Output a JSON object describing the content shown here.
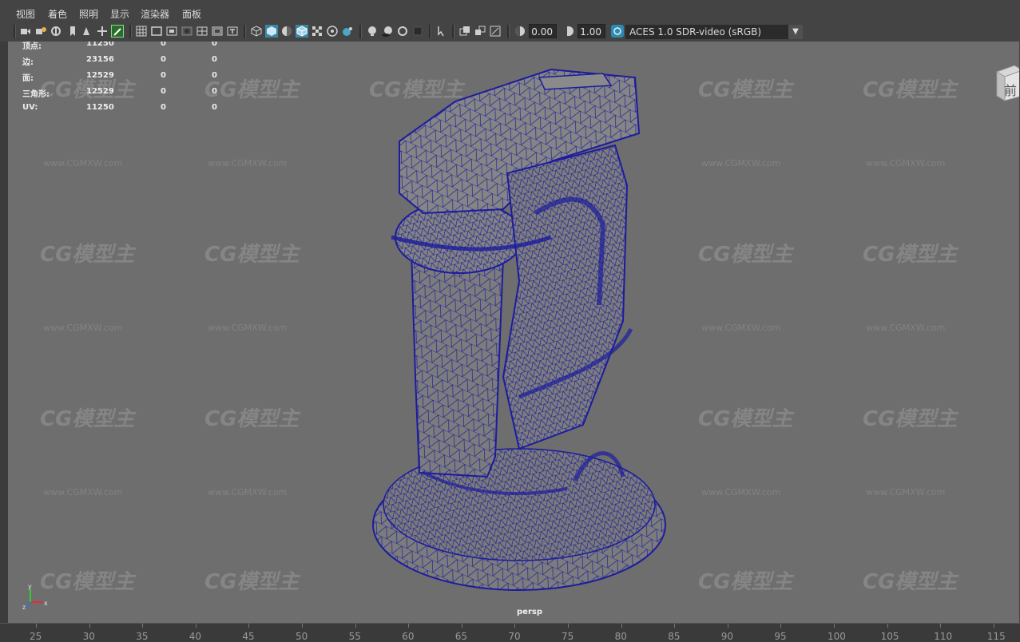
{
  "menu": [
    "视图",
    "着色",
    "照明",
    "显示",
    "渲染器",
    "面板"
  ],
  "toolbar": {
    "exposure": "0.00",
    "gamma": "1.00",
    "colorspace": "ACES 1.0 SDR-video (sRGB)",
    "icons": [
      "camera-icon",
      "camera-attributes-icon",
      "bookmark-icon",
      "image-plane-icon",
      "2d-pan-zoom-icon",
      "grease-pencil-icon",
      "grid-icon",
      "film-gate-icon",
      "resolution-gate-icon",
      "gate-mask-icon",
      "field-chart-icon",
      "safe-action-icon",
      "safe-title-icon",
      "wireframe-icon",
      "smooth-shade-icon",
      "default-material-icon",
      "wireframe-on-shaded-icon",
      "xray-icon",
      "xray-joints-icon",
      "xray-components-icon",
      "use-all-lights-icon",
      "shadows-icon",
      "screen-space-ao-icon",
      "motion-blur-icon",
      "multisample-aa-icon",
      "depth-of-field-icon",
      "isolate-select-icon",
      "heads-up-display-icon",
      "exposure-icon",
      "gamma-icon",
      "color-management-icon"
    ]
  },
  "hud": {
    "rows": [
      {
        "label": "顶点:",
        "v1": "11250",
        "v2": "0",
        "v3": "0"
      },
      {
        "label": "边:",
        "v1": "23156",
        "v2": "0",
        "v3": "0"
      },
      {
        "label": "面:",
        "v1": "12529",
        "v2": "0",
        "v3": "0"
      },
      {
        "label": "三角形:",
        "v1": "12529",
        "v2": "0",
        "v3": "0"
      },
      {
        "label": "UV:",
        "v1": "11250",
        "v2": "0",
        "v3": "0"
      }
    ]
  },
  "watermark": {
    "logo": "CG模型主",
    "url": "www.CGMXW.com"
  },
  "viewport": {
    "camera": "persp",
    "viewcube_face": "前"
  },
  "axis": {
    "x": "x",
    "y": "y",
    "z": "z"
  },
  "timeline": {
    "ticks": [
      "25",
      "30",
      "35",
      "40",
      "45",
      "50",
      "55",
      "60",
      "65",
      "70",
      "75",
      "80",
      "85",
      "90",
      "95",
      "100",
      "105",
      "110",
      "115"
    ]
  },
  "colors": {
    "wire": "#1c1c9e",
    "mesh": "#7c7c7c",
    "viewport": "#6e6e6e"
  }
}
